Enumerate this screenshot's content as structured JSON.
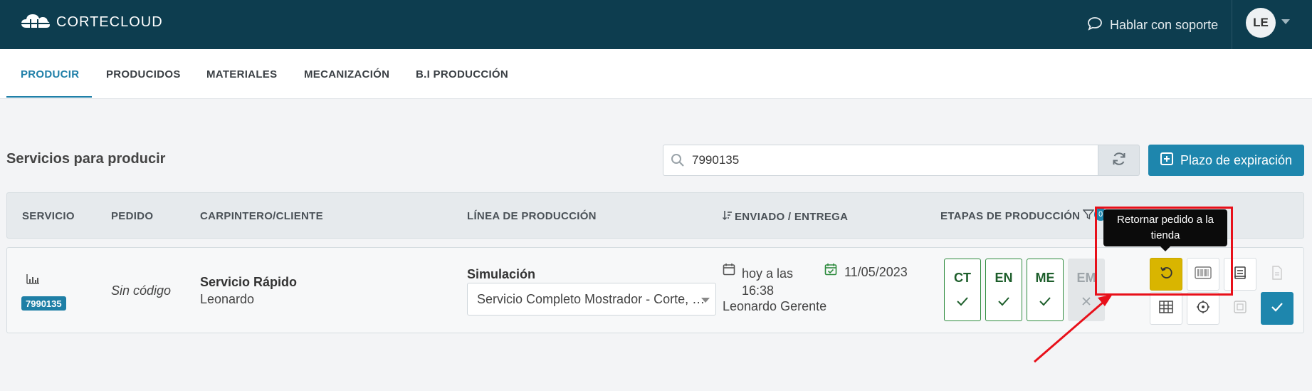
{
  "app": {
    "brand": "CORTECLOUD"
  },
  "header": {
    "support_label": "Hablar con soporte",
    "user_initials": "LE"
  },
  "tabs": [
    {
      "label": "PRODUCIR",
      "active": true
    },
    {
      "label": "PRODUCIDOS"
    },
    {
      "label": "MATERIALES"
    },
    {
      "label": "MECANIZACIÓN"
    },
    {
      "label": "B.I PRODUCCIÓN"
    }
  ],
  "page": {
    "title": "Servicios para producir"
  },
  "search": {
    "value": "7990135"
  },
  "actions": {
    "expire_label": "Plazo de expiración"
  },
  "table": {
    "headers": {
      "servicio": "SERVICIO",
      "pedido": "PEDIDO",
      "cliente": "CARPINTERO/CLIENTE",
      "linea": "LÍNEA DE PRODUCCIÓN",
      "enviado": "ENVIADO / ENTREGA",
      "etapas": "ETAPAS DE PRODUCCIÓN",
      "filter_count": "0"
    },
    "rows": [
      {
        "servicio_code": "7990135",
        "pedido": "Sin código",
        "cliente_name": "Servicio Rápido",
        "cliente_sub": "Leonardo",
        "linea_label": "Simulación",
        "linea_value": "Servicio Completo Mostrador - Corte, …",
        "sent": "hoy a las 16:38",
        "sent_by": "Leonardo Gerente",
        "delivery": "11/05/2023",
        "stages": [
          {
            "label": "CT",
            "done": true
          },
          {
            "label": "EN",
            "done": true
          },
          {
            "label": "ME",
            "done": true
          },
          {
            "label": "EM",
            "done": false
          }
        ]
      }
    ]
  },
  "tooltip": {
    "text": "Retornar pedido a la tienda"
  },
  "colors": {
    "topbar": "#0d3d4f",
    "accent": "#1e86ad",
    "stage_done": "#2e8b3e",
    "return_button": "#d9b500",
    "annotation": "#e8101a"
  }
}
